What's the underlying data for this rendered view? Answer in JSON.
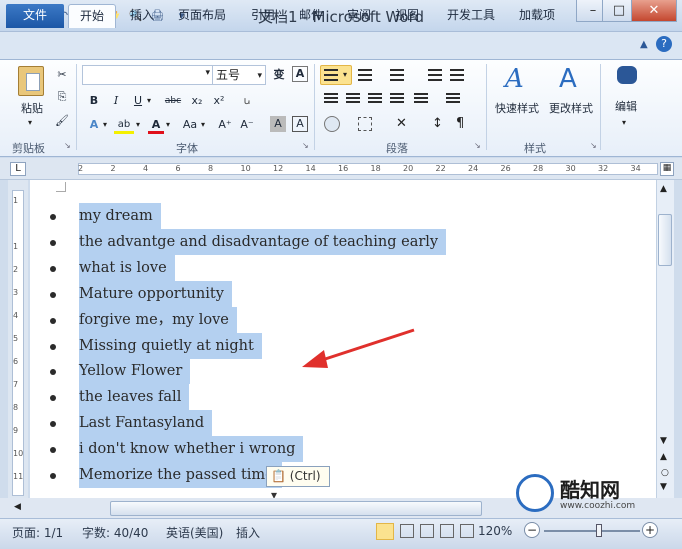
{
  "window": {
    "title": "文档1 - Microsoft Word",
    "app_letter": "W",
    "controls": {
      "minimize": "–",
      "maximize": "□",
      "close": "✕"
    }
  },
  "quick_access": {
    "save": "💾",
    "undo": "↶",
    "redo": "↻",
    "open": "📂",
    "preview": "🔍",
    "print": "🖨",
    "more": "▾"
  },
  "tabs": {
    "file": "文件",
    "home": "开始",
    "insert": "插入",
    "layout": "页面布局",
    "references": "引用",
    "mailings": "邮件",
    "review": "审阅",
    "view": "视图",
    "developer": "开发工具",
    "addins": "加载项"
  },
  "ribbon": {
    "clipboard": {
      "label": "剪贴板",
      "paste": "粘贴",
      "cut": "✂",
      "copy": "⎘",
      "format_painter": "🖌"
    },
    "font": {
      "label": "字体",
      "font_name": "",
      "font_size": "五号",
      "grow": "变",
      "clear": "A",
      "bold": "B",
      "italic": "I",
      "underline": "U",
      "strike": "abc",
      "sub": "x₂",
      "sup": "x²",
      "phonetic": "ꭎ",
      "effects": "A",
      "highlight": "ab",
      "color": "A",
      "case": "Aa",
      "enlarge": "A⁺",
      "shrink": "A⁻",
      "char_shade": "A",
      "char_border": "A"
    },
    "paragraph": {
      "label": "段落"
    },
    "styles": {
      "label": "样式",
      "quick": "快速样式",
      "change": "更改样式"
    },
    "editing": {
      "label": "编辑"
    }
  },
  "ruler": {
    "corner": "L",
    "ticks": [
      "2",
      "2",
      "4",
      "6",
      "8",
      "10",
      "12",
      "14",
      "16",
      "18",
      "20",
      "22",
      "24",
      "26",
      "28",
      "30",
      "32",
      "34"
    ],
    "vticks": [
      "1",
      "",
      "1",
      "2",
      "3",
      "4",
      "5",
      "6",
      "7",
      "8",
      "9",
      "10",
      "11"
    ]
  },
  "document": {
    "items": [
      "my dream",
      "the advantge and disadvantage of teaching early",
      "what is love",
      "Mature opportunity",
      "forgive me，my love",
      "Missing quietly at night",
      "Yellow Flower",
      "the leaves fall",
      "Last Fantasyland",
      "i don't know whether i wrong",
      "Memorize the passed time"
    ],
    "paste_tag": "(Ctrl)",
    "paste_icon": "📋"
  },
  "status": {
    "page": "页面: 1/1",
    "words": "字数: 40/40",
    "language": "英语(美国)",
    "mode": "插入",
    "zoom": "120%",
    "zoom_out": "−",
    "zoom_in": "+"
  },
  "watermark": {
    "name": "酷知网",
    "url": "www.coozhi.com"
  },
  "colors": {
    "accent": "#2b5797",
    "selection": "#b4d0f0",
    "arrow": "#e0302c"
  }
}
